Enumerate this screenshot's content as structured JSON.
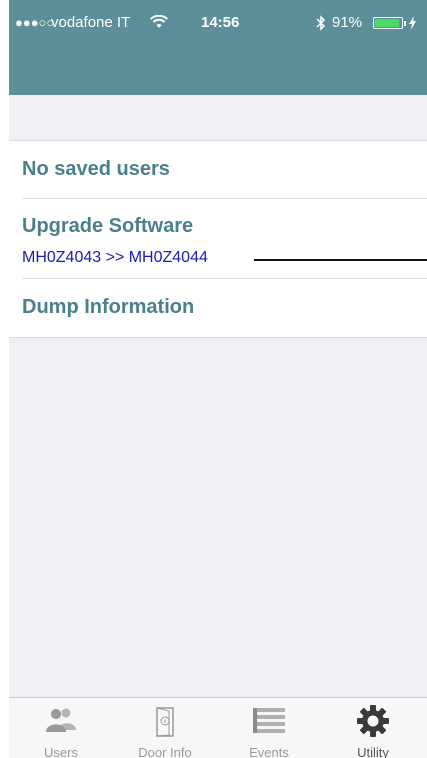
{
  "status_bar": {
    "signal": "●●●○○",
    "carrier": "vodafone IT",
    "time": "14:56",
    "battery": "91%",
    "battery_level": 0.91
  },
  "list": {
    "items": [
      {
        "title": "No saved users"
      },
      {
        "title": "Upgrade Software",
        "subtitle": "MH0Z4043 >> MH0Z4044"
      },
      {
        "title": "Dump Information"
      }
    ]
  },
  "tabbar": {
    "tabs": [
      {
        "label": "Users",
        "icon": "users-icon"
      },
      {
        "label": "Door Info",
        "icon": "door-info-icon"
      },
      {
        "label": "Events",
        "icon": "events-icon"
      },
      {
        "label": "Utility",
        "icon": "gear-icon",
        "active": true
      }
    ]
  },
  "colors": {
    "header": "#5d8f9b",
    "item_title": "#4a7f8c",
    "version_text": "#1a1ab8"
  }
}
